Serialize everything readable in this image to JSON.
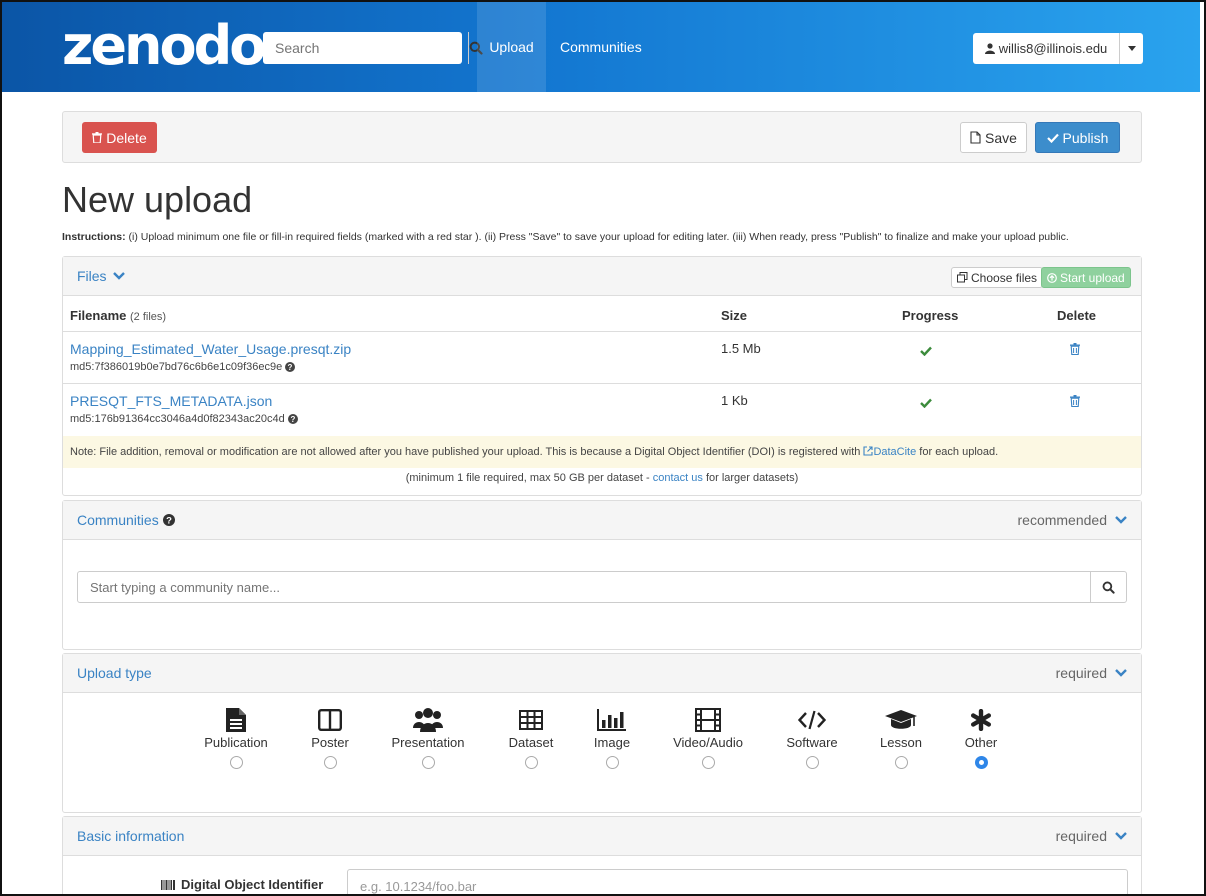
{
  "brand": {
    "logo": "zenodo"
  },
  "nav": {
    "search_placeholder": "Search",
    "upload": "Upload",
    "communities": "Communities",
    "user": "willis8@illinois.edu"
  },
  "actions": {
    "delete": "Delete",
    "save": "Save",
    "publish": "Publish"
  },
  "page": {
    "title": "New upload",
    "instructions_label": "Instructions:",
    "instructions_text": "(i) Upload minimum one file or fill-in required fields (marked with a red star ). (ii) Press \"Save\" to save your upload for editing later. (iii) When ready, press \"Publish\" to finalize and make your upload public."
  },
  "files": {
    "heading": "Files",
    "choose": "Choose files",
    "start": "Start upload",
    "col_filename": "Filename",
    "col_filecount": "(2 files)",
    "col_size": "Size",
    "col_progress": "Progress",
    "col_delete": "Delete",
    "rows": [
      {
        "name": "Mapping_Estimated_Water_Usage.presqt.zip",
        "md5": "md5:7f386019b0e7bd76c6b6e1c09f36ec9e",
        "size": "1.5 Mb"
      },
      {
        "name": "PRESQT_FTS_METADATA.json",
        "md5": "md5:176b91364cc3046a4d0f82343ac20c4d",
        "size": "1 Kb"
      }
    ],
    "note_prefix": "Note: File addition, removal or modification are not allowed after you have published your upload. This is because a Digital Object Identifier (DOI) is registered with",
    "note_link": "DataCite",
    "note_suffix": "for each upload.",
    "min_prefix": "(minimum 1 file required, max 50 GB per dataset -",
    "min_link": "contact us",
    "min_suffix": "for larger datasets)"
  },
  "communities": {
    "heading": "Communities",
    "status": "recommended",
    "placeholder": "Start typing a community name..."
  },
  "upload_type": {
    "heading": "Upload type",
    "status": "required",
    "options": [
      {
        "label": "Publication",
        "icon": "file-text-icon"
      },
      {
        "label": "Poster",
        "icon": "columns-icon"
      },
      {
        "label": "Presentation",
        "icon": "users-icon"
      },
      {
        "label": "Dataset",
        "icon": "table-icon"
      },
      {
        "label": "Image",
        "icon": "bar-chart-icon"
      },
      {
        "label": "Video/Audio",
        "icon": "film-icon"
      },
      {
        "label": "Software",
        "icon": "code-icon"
      },
      {
        "label": "Lesson",
        "icon": "graduation-cap-icon"
      },
      {
        "label": "Other",
        "icon": "asterisk-icon"
      }
    ],
    "selected": "Other"
  },
  "basic": {
    "heading": "Basic information",
    "status": "required",
    "doi_label": "Digital Object Identifier",
    "doi_placeholder": "e.g. 10.1234/foo.bar"
  },
  "colors": {
    "accent": "#3a83c4",
    "danger": "#d9534f",
    "success": "#3c8b3c",
    "nav_start": "#0b55a6",
    "nav_end": "#2aa3ee"
  }
}
